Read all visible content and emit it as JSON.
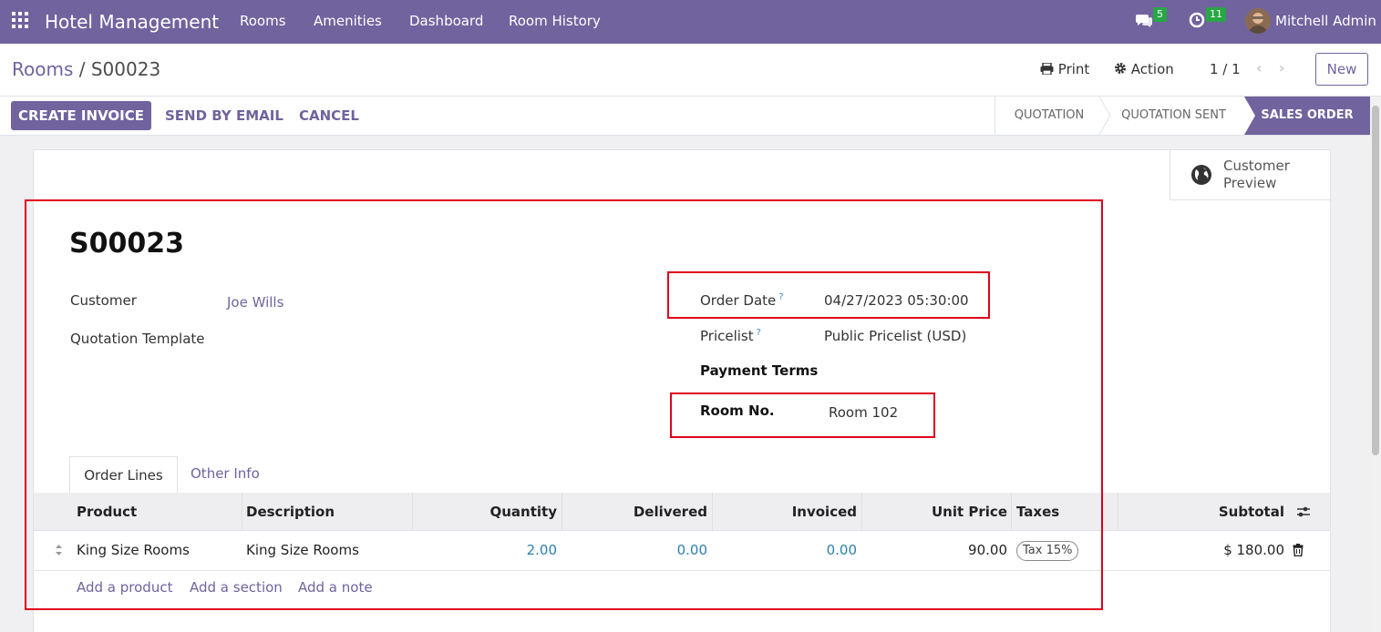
{
  "navbar": {
    "brand": "Hotel Management",
    "menu": [
      "Rooms",
      "Amenities",
      "Dashboard",
      "Room History"
    ],
    "chat_count": "5",
    "activity_count": "11",
    "user": "Mitchell Admin"
  },
  "control_panel": {
    "breadcrumb_root": "Rooms",
    "breadcrumb_sep": "/",
    "breadcrumb_current": "S00023",
    "print_label": "Print",
    "action_label": "Action",
    "pager": "1 / 1",
    "new_label": "New"
  },
  "statusbar": {
    "create_invoice": "CREATE INVOICE",
    "send_email": "SEND BY EMAIL",
    "cancel": "CANCEL",
    "stages": [
      "QUOTATION",
      "QUOTATION SENT",
      "SALES ORDER"
    ],
    "active_stage": "SALES ORDER"
  },
  "sheet": {
    "preview_line1": "Customer",
    "preview_line2": "Preview",
    "title": "S00023",
    "customer_label": "Customer",
    "customer_value": "Joe Wills",
    "template_label": "Quotation Template",
    "order_date_label": "Order Date",
    "order_date_value": "04/27/2023 05:30:00",
    "pricelist_label": "Pricelist",
    "pricelist_value": "Public Pricelist (USD)",
    "payment_terms_label": "Payment Terms",
    "room_label": "Room No.",
    "room_value": "Room 102",
    "help_mark": "?"
  },
  "tabs": [
    "Order Lines",
    "Other Info"
  ],
  "order_lines": {
    "headers": {
      "product": "Product",
      "description": "Description",
      "quantity": "Quantity",
      "delivered": "Delivered",
      "invoiced": "Invoiced",
      "unit_price": "Unit Price",
      "taxes": "Taxes",
      "subtotal": "Subtotal"
    },
    "rows": [
      {
        "product": "King Size Rooms",
        "description": "King Size Rooms",
        "quantity": "2.00",
        "delivered": "0.00",
        "invoiced": "0.00",
        "unit_price": "90.00",
        "tax": "Tax 15%",
        "subtotal": "$ 180.00"
      }
    ],
    "add_product": "Add a product",
    "add_section": "Add a section",
    "add_note": "Add a note"
  },
  "colors": {
    "brand": "#71639e",
    "highlight_box": "#e0001b",
    "badge": "#28a745"
  }
}
